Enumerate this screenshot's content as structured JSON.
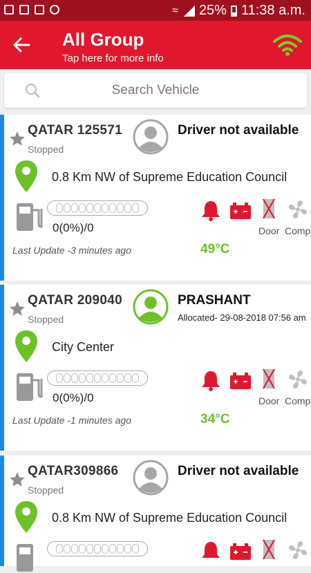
{
  "status_bar": {
    "battery": "25%",
    "time": "11:38 a.m."
  },
  "header": {
    "title": "All Group",
    "subtitle": "Tap here for more info"
  },
  "search": {
    "placeholder": "Search Vehicle"
  },
  "labels": {
    "door": "Door",
    "comp": "Comp"
  },
  "colors": {
    "primary": "#e0172d",
    "accent_green": "#6ec02a",
    "alert_red": "#e0172d",
    "card_border": "#1e88e5"
  },
  "vehicles": [
    {
      "id": "QATAR 125571",
      "status": "Stopped",
      "driver": "Driver not available",
      "allocated": "",
      "avatar_state": "unassigned",
      "location": "0.8 Km NW of Supreme Education Council",
      "fuel_text": "0(0%)/0",
      "last_update": "Last Update -3 minutes ago",
      "temperature": "49°C"
    },
    {
      "id": "QATAR 209040",
      "status": "Stopped",
      "driver": "PRASHANT",
      "allocated": "Allocated- 29-08-2018 07:56 am",
      "avatar_state": "assigned",
      "location": "City Center",
      "fuel_text": "0(0%)/0",
      "last_update": "Last Update -1 minutes ago",
      "temperature": "34°C"
    },
    {
      "id": "QATAR309866",
      "status": "Stopped",
      "driver": "Driver not available",
      "allocated": "",
      "avatar_state": "unassigned",
      "location": "0.8 Km NW of Supreme Education Council",
      "fuel_text": "",
      "last_update": "",
      "temperature": ""
    }
  ]
}
